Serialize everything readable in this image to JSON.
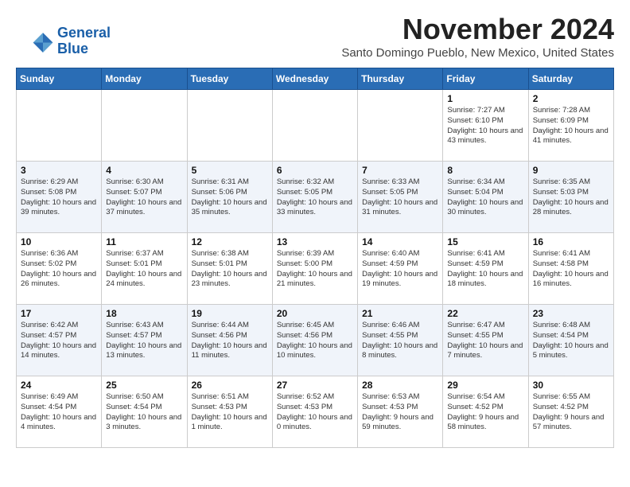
{
  "logo": {
    "line1": "General",
    "line2": "Blue"
  },
  "header": {
    "title": "November 2024",
    "subtitle": "Santo Domingo Pueblo, New Mexico, United States"
  },
  "weekdays": [
    "Sunday",
    "Monday",
    "Tuesday",
    "Wednesday",
    "Thursday",
    "Friday",
    "Saturday"
  ],
  "weeks": [
    [
      {
        "day": "",
        "info": ""
      },
      {
        "day": "",
        "info": ""
      },
      {
        "day": "",
        "info": ""
      },
      {
        "day": "",
        "info": ""
      },
      {
        "day": "",
        "info": ""
      },
      {
        "day": "1",
        "info": "Sunrise: 7:27 AM\nSunset: 6:10 PM\nDaylight: 10 hours and 43 minutes."
      },
      {
        "day": "2",
        "info": "Sunrise: 7:28 AM\nSunset: 6:09 PM\nDaylight: 10 hours and 41 minutes."
      }
    ],
    [
      {
        "day": "3",
        "info": "Sunrise: 6:29 AM\nSunset: 5:08 PM\nDaylight: 10 hours and 39 minutes."
      },
      {
        "day": "4",
        "info": "Sunrise: 6:30 AM\nSunset: 5:07 PM\nDaylight: 10 hours and 37 minutes."
      },
      {
        "day": "5",
        "info": "Sunrise: 6:31 AM\nSunset: 5:06 PM\nDaylight: 10 hours and 35 minutes."
      },
      {
        "day": "6",
        "info": "Sunrise: 6:32 AM\nSunset: 5:05 PM\nDaylight: 10 hours and 33 minutes."
      },
      {
        "day": "7",
        "info": "Sunrise: 6:33 AM\nSunset: 5:05 PM\nDaylight: 10 hours and 31 minutes."
      },
      {
        "day": "8",
        "info": "Sunrise: 6:34 AM\nSunset: 5:04 PM\nDaylight: 10 hours and 30 minutes."
      },
      {
        "day": "9",
        "info": "Sunrise: 6:35 AM\nSunset: 5:03 PM\nDaylight: 10 hours and 28 minutes."
      }
    ],
    [
      {
        "day": "10",
        "info": "Sunrise: 6:36 AM\nSunset: 5:02 PM\nDaylight: 10 hours and 26 minutes."
      },
      {
        "day": "11",
        "info": "Sunrise: 6:37 AM\nSunset: 5:01 PM\nDaylight: 10 hours and 24 minutes."
      },
      {
        "day": "12",
        "info": "Sunrise: 6:38 AM\nSunset: 5:01 PM\nDaylight: 10 hours and 23 minutes."
      },
      {
        "day": "13",
        "info": "Sunrise: 6:39 AM\nSunset: 5:00 PM\nDaylight: 10 hours and 21 minutes."
      },
      {
        "day": "14",
        "info": "Sunrise: 6:40 AM\nSunset: 4:59 PM\nDaylight: 10 hours and 19 minutes."
      },
      {
        "day": "15",
        "info": "Sunrise: 6:41 AM\nSunset: 4:59 PM\nDaylight: 10 hours and 18 minutes."
      },
      {
        "day": "16",
        "info": "Sunrise: 6:41 AM\nSunset: 4:58 PM\nDaylight: 10 hours and 16 minutes."
      }
    ],
    [
      {
        "day": "17",
        "info": "Sunrise: 6:42 AM\nSunset: 4:57 PM\nDaylight: 10 hours and 14 minutes."
      },
      {
        "day": "18",
        "info": "Sunrise: 6:43 AM\nSunset: 4:57 PM\nDaylight: 10 hours and 13 minutes."
      },
      {
        "day": "19",
        "info": "Sunrise: 6:44 AM\nSunset: 4:56 PM\nDaylight: 10 hours and 11 minutes."
      },
      {
        "day": "20",
        "info": "Sunrise: 6:45 AM\nSunset: 4:56 PM\nDaylight: 10 hours and 10 minutes."
      },
      {
        "day": "21",
        "info": "Sunrise: 6:46 AM\nSunset: 4:55 PM\nDaylight: 10 hours and 8 minutes."
      },
      {
        "day": "22",
        "info": "Sunrise: 6:47 AM\nSunset: 4:55 PM\nDaylight: 10 hours and 7 minutes."
      },
      {
        "day": "23",
        "info": "Sunrise: 6:48 AM\nSunset: 4:54 PM\nDaylight: 10 hours and 5 minutes."
      }
    ],
    [
      {
        "day": "24",
        "info": "Sunrise: 6:49 AM\nSunset: 4:54 PM\nDaylight: 10 hours and 4 minutes."
      },
      {
        "day": "25",
        "info": "Sunrise: 6:50 AM\nSunset: 4:54 PM\nDaylight: 10 hours and 3 minutes."
      },
      {
        "day": "26",
        "info": "Sunrise: 6:51 AM\nSunset: 4:53 PM\nDaylight: 10 hours and 1 minute."
      },
      {
        "day": "27",
        "info": "Sunrise: 6:52 AM\nSunset: 4:53 PM\nDaylight: 10 hours and 0 minutes."
      },
      {
        "day": "28",
        "info": "Sunrise: 6:53 AM\nSunset: 4:53 PM\nDaylight: 9 hours and 59 minutes."
      },
      {
        "day": "29",
        "info": "Sunrise: 6:54 AM\nSunset: 4:52 PM\nDaylight: 9 hours and 58 minutes."
      },
      {
        "day": "30",
        "info": "Sunrise: 6:55 AM\nSunset: 4:52 PM\nDaylight: 9 hours and 57 minutes."
      }
    ]
  ]
}
